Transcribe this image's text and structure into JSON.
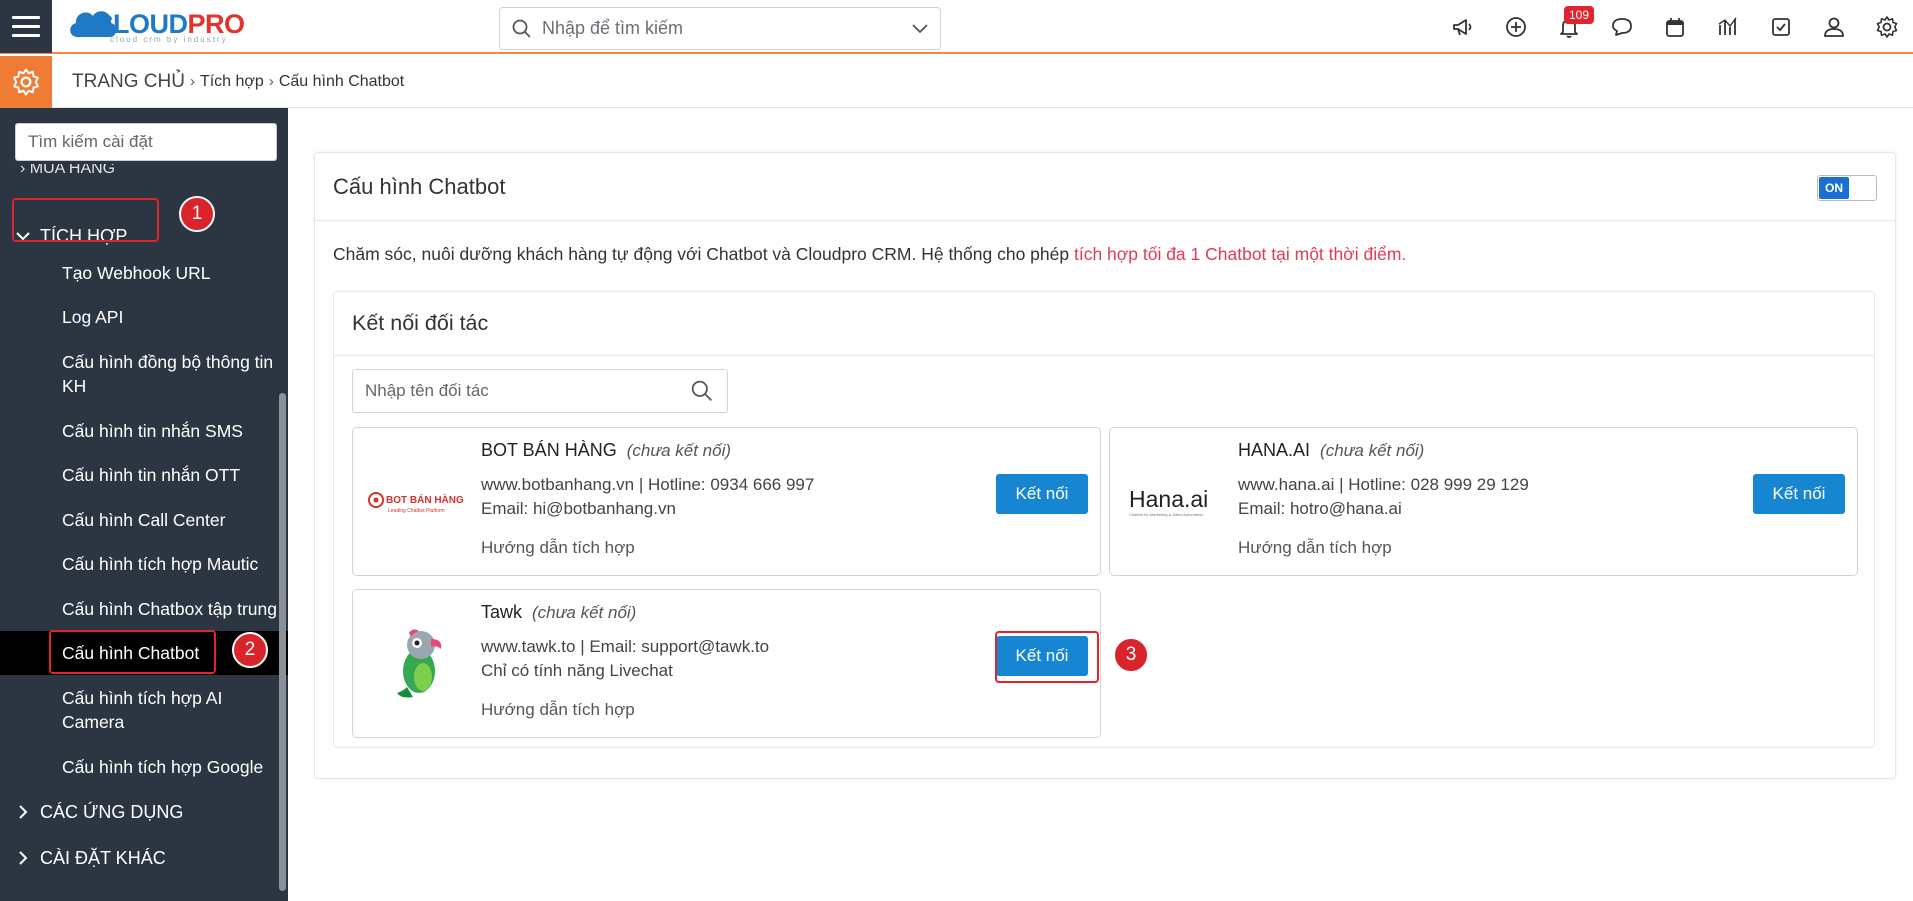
{
  "topbar": {
    "logo_text_a": "CLOUD",
    "logo_text_b": "PRO",
    "logo_tagline": "cloud crm by industry",
    "search_placeholder": "Nhập để tìm kiếm",
    "notification_count": "109",
    "icons": [
      "megaphone-icon",
      "plus-circle-icon",
      "bell-icon",
      "chat-icon",
      "calendar-icon",
      "chart-icon",
      "checkbox-icon",
      "user-icon",
      "gear-icon"
    ]
  },
  "breadcrumb": {
    "home": "TRANG CHỦ",
    "level1": "Tích hợp",
    "level2": "Cấu hình Chatbot"
  },
  "sidebar": {
    "search_placeholder": "Tìm kiếm cài đặt",
    "cut_item": "MUA HÀNG",
    "group_active": "TÍCH HỢP",
    "items": [
      "Tạo Webhook URL",
      "Log API",
      "Cấu hình đồng bộ thông tin KH",
      "Cấu hình tin nhắn SMS",
      "Cấu hình tin nhắn OTT",
      "Cấu hình Call Center",
      "Cấu hình tích hợp Mautic",
      "Cấu hình Chatbox tập trung",
      "Cấu hình Chatbot",
      "Cấu hình tích hợp AI Camera",
      "Cấu hình tích hợp Google"
    ],
    "group_apps": "CÁC ỨNG DỤNG",
    "group_other": "CÀI ĐẶT KHÁC",
    "step1": "1",
    "step2": "2"
  },
  "main": {
    "title": "Cấu hình Chatbot",
    "toggle_label": "ON",
    "desc_plain": "Chăm sóc, nuôi dưỡng khách hàng tự động với Chatbot và Cloudpro CRM. Hệ thống cho phép ",
    "desc_highlight": "tích hợp tối đa 1 Chatbot tại một thời điểm.",
    "partners_title": "Kết nối đối tác",
    "partner_search_placeholder": "Nhập tên đối tác",
    "step3": "3",
    "partners": [
      {
        "name": "BOT BÁN HÀNG",
        "status": "(chưa kết nối)",
        "line1": "www.botbanhang.vn | Hotline: 0934 666 997",
        "line2": "Email: hi@botbanhang.vn",
        "guide": "Hướng dẫn tích hợp",
        "button": "Kết nối",
        "logo_text": "BOT BÁN HÀNG",
        "logo_sub": "Leading Chatbot Platform"
      },
      {
        "name": "HANA.AI",
        "status": "(chưa kết nối)",
        "line1": "www.hana.ai | Hotline: 028 999 29 129",
        "line2": "Email: hotro@hana.ai",
        "guide": "Hướng dẫn tích hợp",
        "button": "Kết nối",
        "logo_text": "Hana.ai",
        "logo_sub": "Chatbot for Marketing & Sales Automation"
      },
      {
        "name": "Tawk",
        "status": "(chưa kết nối)",
        "line1": "www.tawk.to | Email: support@tawk.to",
        "line2": "Chỉ có tính năng Livechat",
        "guide": "Hướng dẫn tích hợp",
        "button": "Kết nối"
      }
    ]
  },
  "colors": {
    "sidebar_bg": "#2c3642",
    "accent_orange": "#f07b35",
    "button_blue": "#1786d2",
    "annotation_red": "#e0252e",
    "highlight_pink": "#e03b57"
  }
}
